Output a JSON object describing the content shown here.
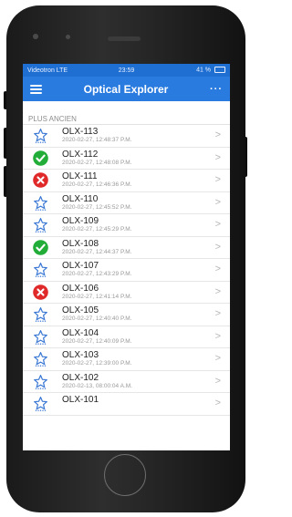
{
  "status": {
    "carrier": "Videotron  LTE",
    "time": "23:59",
    "battery": "41 %"
  },
  "nav": {
    "title": "Optical Explorer",
    "more": "···"
  },
  "section": "PLUS ANCIEN",
  "colors": {
    "nav": "#2a7be0",
    "success": "#22ad38",
    "error": "#e02a2a",
    "star": "#3a78d4"
  },
  "items": [
    {
      "id": "OLX-113",
      "time": "2020-02-27, 12:48:37 P.M.",
      "icon": "star-outline-icon"
    },
    {
      "id": "OLX-112",
      "time": "2020-02-27, 12:48:08 P.M.",
      "icon": "check-circle-icon"
    },
    {
      "id": "OLX-111",
      "time": "2020-02-27, 12:46:36 P.M.",
      "icon": "error-circle-icon"
    },
    {
      "id": "OLX-110",
      "time": "2020-02-27, 12:45:52 P.M.",
      "icon": "star-outline-icon"
    },
    {
      "id": "OLX-109",
      "time": "2020-02-27, 12:45:29 P.M.",
      "icon": "star-outline-icon"
    },
    {
      "id": "OLX-108",
      "time": "2020-02-27, 12:44:37 P.M.",
      "icon": "check-circle-icon"
    },
    {
      "id": "OLX-107",
      "time": "2020-02-27, 12:43:29 P.M.",
      "icon": "star-outline-icon"
    },
    {
      "id": "OLX-106",
      "time": "2020-02-27, 12:41:14 P.M.",
      "icon": "error-circle-icon"
    },
    {
      "id": "OLX-105",
      "time": "2020-02-27, 12:40:40 P.M.",
      "icon": "star-outline-icon"
    },
    {
      "id": "OLX-104",
      "time": "2020-02-27, 12:40:09 P.M.",
      "icon": "star-outline-icon"
    },
    {
      "id": "OLX-103",
      "time": "2020-02-27, 12:39:00 P.M.",
      "icon": "star-outline-icon"
    },
    {
      "id": "OLX-102",
      "time": "2020-02-13, 08:00:04 A.M.",
      "icon": "star-outline-icon"
    },
    {
      "id": "OLX-101",
      "time": "",
      "icon": "star-outline-icon"
    }
  ]
}
